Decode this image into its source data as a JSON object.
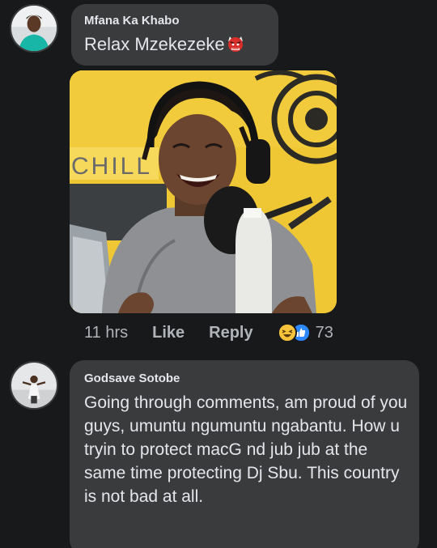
{
  "comments": [
    {
      "author": "Mfana Ka Khabo",
      "text": "Relax Mzekezeke",
      "emoji": "ogre-mask-emoji",
      "time": "11 hrs",
      "like_label": "Like",
      "reply_label": "Reply",
      "reactions": [
        "haha-reaction",
        "like-reaction"
      ],
      "reaction_count": "73",
      "photo_sign_text": "CHILL",
      "photo_description_icon": "attached-photo"
    },
    {
      "author": "Godsave Sotobe",
      "text": "Going through comments, am proud of you guys, umuntu ngumuntu ngabantu. How u tryin to protect macG nd jub jub at the same time protecting Dj Sbu. This country is not bad at all."
    }
  ],
  "colors": {
    "background": "#18191a",
    "bubble": "#3a3b3c",
    "text": "#e4e6eb",
    "secondary_text": "#b0b3b8",
    "like_blue": "#2d88ff",
    "haha_yellow": "#f7c33a"
  }
}
